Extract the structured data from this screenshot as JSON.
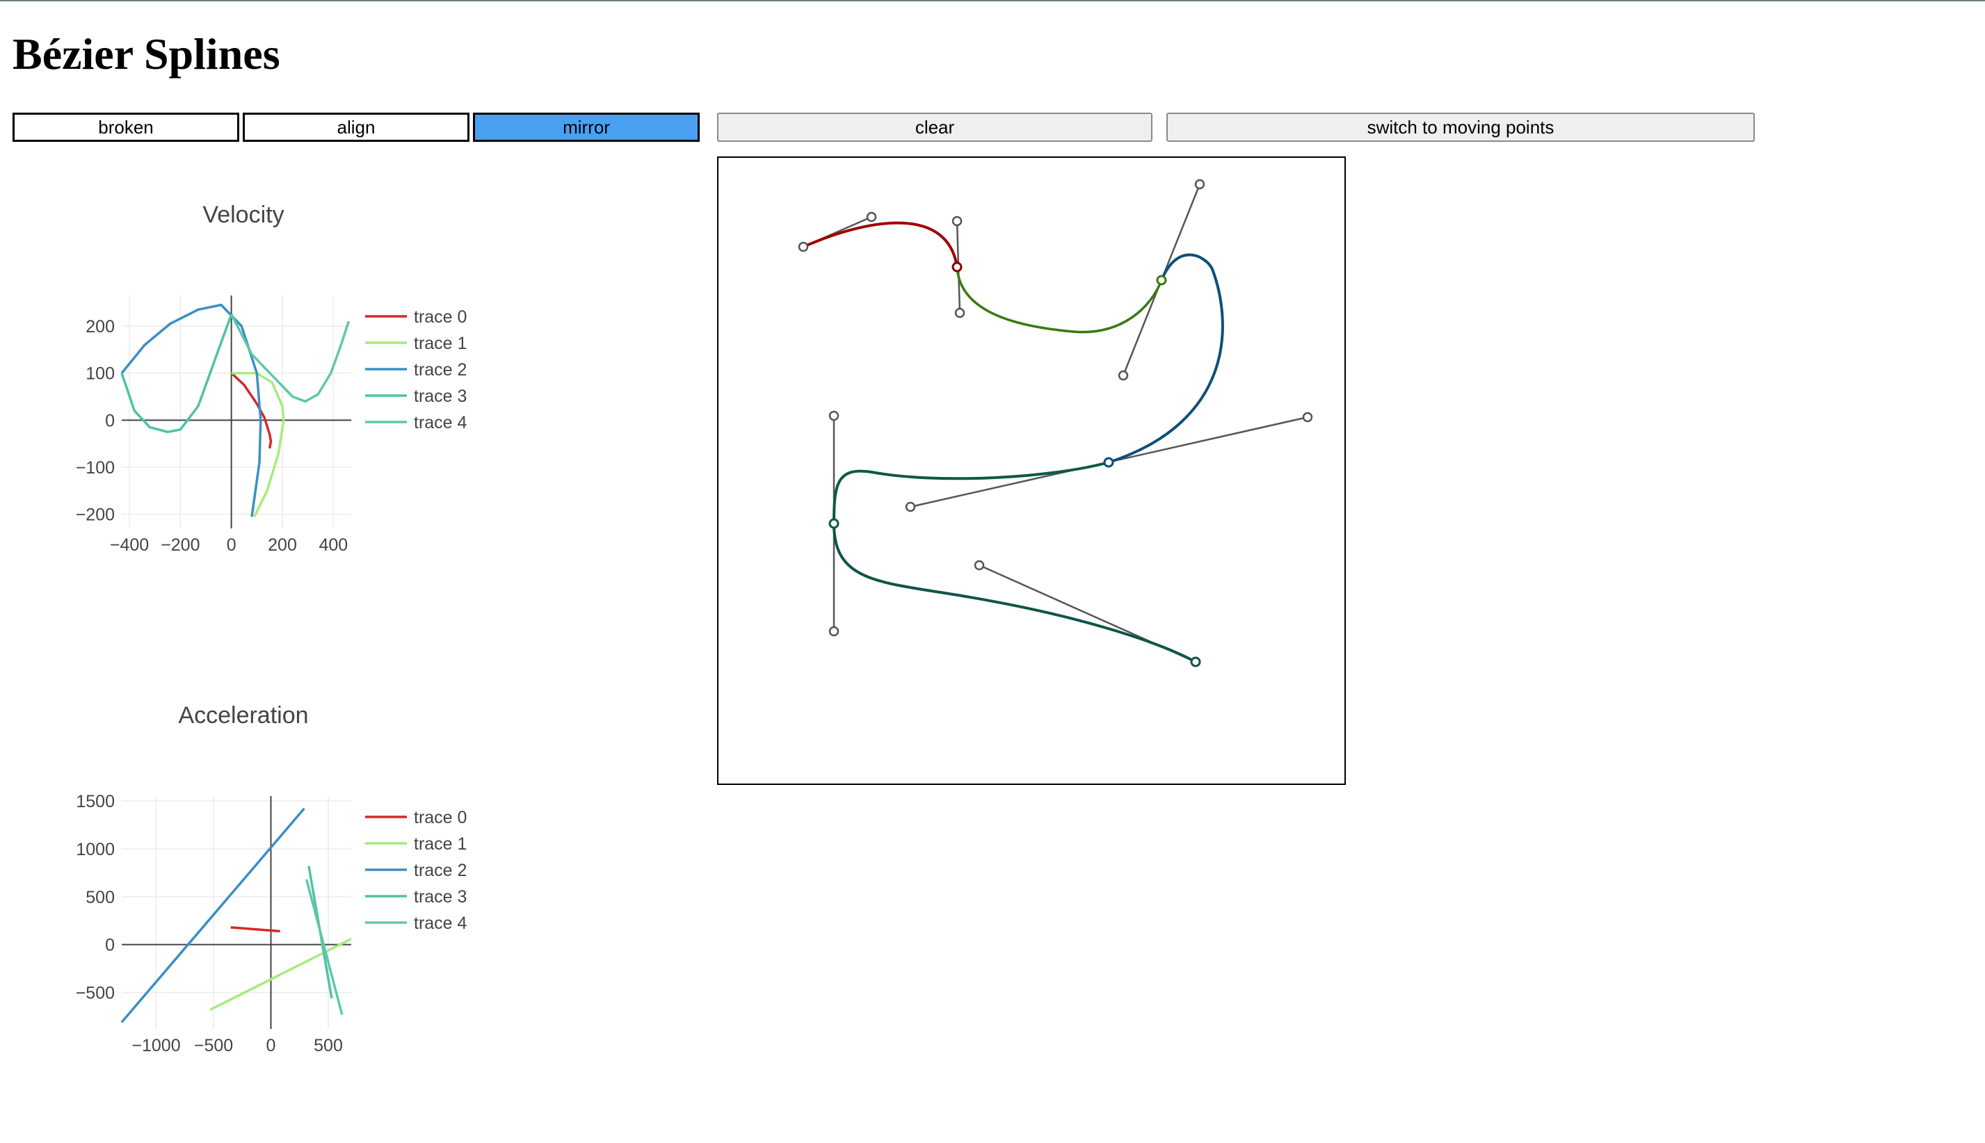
{
  "app": {
    "title": "Bézier Splines"
  },
  "toolbar": {
    "modes": [
      {
        "label": "broken",
        "active": false
      },
      {
        "label": "align",
        "active": false
      },
      {
        "label": "mirror",
        "active": true
      }
    ],
    "clear_label": "clear",
    "switch_label": "switch to moving points"
  },
  "colors": {
    "active_mode": "#4aa0f0",
    "trace_0": "#d62728",
    "trace_1": "#a6ec7a",
    "trace_2": "#3b8fc4",
    "trace_3": "#4fc2a6",
    "trace_4": "#5ec8a8",
    "handle": "#555555"
  },
  "chart_data": [
    {
      "type": "line",
      "title": "Velocity",
      "xlim": [
        -430,
        470
      ],
      "ylim": [
        -230,
        265
      ],
      "xticks": [
        -400,
        -200,
        0,
        200,
        400
      ],
      "xtick_labels": [
        "−400",
        "−200",
        "0",
        "200",
        "400"
      ],
      "yticks": [
        -200,
        -100,
        0,
        100,
        200
      ],
      "ytick_labels": [
        "−200",
        "−100",
        "0",
        "100",
        "200"
      ],
      "grid": true,
      "legend": "right",
      "series": [
        {
          "name": "trace 0",
          "x": [
            0,
            50,
            100,
            130,
            150,
            155,
            150
          ],
          "y": [
            100,
            75,
            35,
            5,
            -30,
            -45,
            -60
          ]
        },
        {
          "name": "trace 1",
          "x": [
            0,
            100,
            160,
            200,
            205,
            185,
            140,
            90
          ],
          "y": [
            100,
            100,
            80,
            30,
            0,
            -70,
            -150,
            -205
          ]
        },
        {
          "name": "trace 2",
          "x": [
            -430,
            -340,
            -240,
            -130,
            -40,
            40,
            100,
            115,
            110,
            80
          ],
          "y": [
            100,
            160,
            205,
            235,
            245,
            200,
            100,
            0,
            -90,
            -205
          ]
        },
        {
          "name": "trace 3",
          "x": [
            -430,
            -380,
            -320,
            -250,
            -200,
            -130,
            -50,
            0
          ],
          "y": [
            100,
            20,
            -15,
            -25,
            -20,
            30,
            150,
            225
          ]
        },
        {
          "name": "trace 4",
          "x": [
            0,
            80,
            160,
            240,
            290,
            340,
            390,
            430,
            460
          ],
          "y": [
            225,
            140,
            95,
            50,
            40,
            55,
            100,
            160,
            210
          ]
        }
      ]
    },
    {
      "type": "line",
      "title": "Acceleration",
      "xlim": [
        -1300,
        700
      ],
      "ylim": [
        -880,
        1550
      ],
      "xticks": [
        -1000,
        -500,
        0,
        500
      ],
      "xtick_labels": [
        "−1000",
        "−500",
        "0",
        "500"
      ],
      "yticks": [
        -500,
        0,
        500,
        1000,
        1500
      ],
      "ytick_labels": [
        "−500",
        "0",
        "500",
        "1000",
        "1500"
      ],
      "grid": true,
      "legend": "right",
      "series": [
        {
          "name": "trace 0",
          "x": [
            -350,
            80
          ],
          "y": [
            180,
            140
          ]
        },
        {
          "name": "trace 1",
          "x": [
            -530,
            700
          ],
          "y": [
            -680,
            60
          ]
        },
        {
          "name": "trace 2",
          "x": [
            -1300,
            290
          ],
          "y": [
            -810,
            1420
          ]
        },
        {
          "name": "trace 3",
          "x": [
            330,
            530
          ],
          "y": [
            820,
            -560
          ]
        },
        {
          "name": "trace 4",
          "x": [
            310,
            620
          ],
          "y": [
            680,
            -730
          ]
        }
      ]
    }
  ]
}
